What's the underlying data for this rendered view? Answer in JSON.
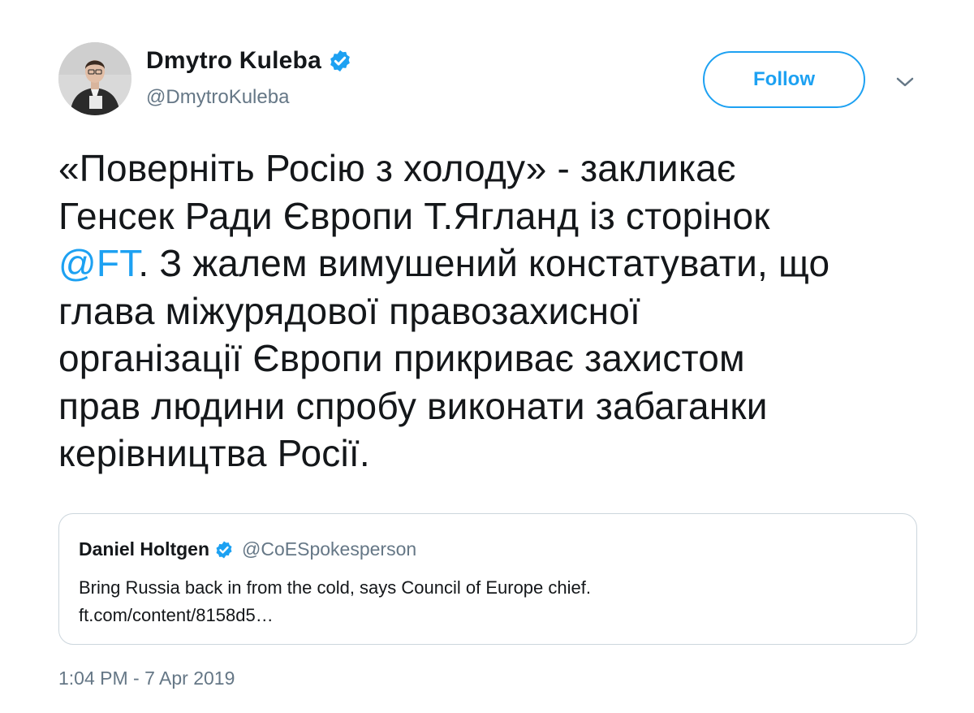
{
  "author": {
    "name": "Dmytro Kuleba",
    "handle": "@DmytroKuleba",
    "verified_icon": "verified-badge-icon"
  },
  "follow_button": {
    "label": "Follow"
  },
  "more_menu_icon": "chevron-down-icon",
  "tweet": {
    "lines": [
      "«Поверніть Росію з холоду» - закликає",
      "Генсек Ради Європи Т.Ягланд із сторінок",
      "@FT",
      ". З жалем вимушений констатувати, що",
      "глава міжурядової правозахисної",
      "організації Європи прикриває захистом",
      "прав людини спробу виконати забаганки",
      "керівництва Росії."
    ]
  },
  "quoted_tweet": {
    "name": "Daniel Holtgen",
    "handle": "@CoESpokesperson",
    "text_line1": "Bring Russia back in from the cold, says Council of Europe chief.",
    "text_line2": "ft.com/content/8158d5…"
  },
  "timestamp": "1:04 PM - 7 Apr 2019",
  "colors": {
    "accent": "#1da1f2",
    "text": "#14171a",
    "secondary": "#657786",
    "border": "#ccd6dd"
  }
}
